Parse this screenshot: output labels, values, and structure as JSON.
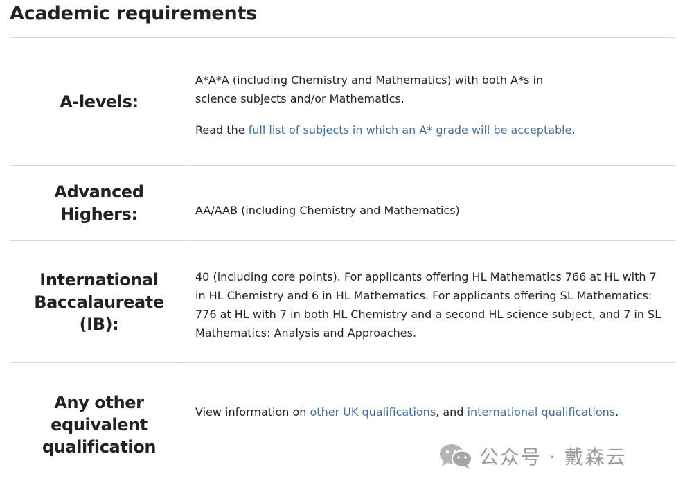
{
  "page": {
    "title": "Academic requirements"
  },
  "requirements": [
    {
      "qualification": "A-levels:",
      "paragraphs": [
        {
          "segments": [
            {
              "text": "A*A*A (including Chemistry and Mathematics) with both A*s in science subjects and/or Mathematics.",
              "link": false
            }
          ]
        },
        {
          "segments": [
            {
              "text": "Read the ",
              "link": false
            },
            {
              "text": "full list of subjects in which an A* grade will be acceptable",
              "link": true
            },
            {
              "text": ".",
              "link": false
            }
          ]
        }
      ]
    },
    {
      "qualification": "Advanced Highers:",
      "paragraphs": [
        {
          "segments": [
            {
              "text": "AA/AAB (including Chemistry and Mathematics)",
              "link": false
            }
          ]
        }
      ]
    },
    {
      "qualification": "International Baccalaureate (IB):",
      "paragraphs": [
        {
          "segments": [
            {
              "text": "40 (including core points). For applicants offering HL Mathematics 766 at HL with 7 in HL Chemistry and 6 in HL Mathematics. For applicants offering SL Mathematics: 776 at HL with 7 in both HL Chemistry and a second HL science subject, and 7 in SL Mathematics: Analysis and Approaches.",
              "link": false
            }
          ]
        }
      ]
    },
    {
      "qualification": "Any other equivalent qualification",
      "paragraphs": [
        {
          "segments": [
            {
              "text": "View information on ",
              "link": false
            },
            {
              "text": "other UK qualifications",
              "link": true
            },
            {
              "text": ", and ",
              "link": false
            },
            {
              "text": "international qualifications",
              "link": true
            },
            {
              "text": ".",
              "link": false
            }
          ]
        }
      ]
    }
  ],
  "watermark": {
    "text": "公众号 · 戴森云",
    "icon": "wechat-icon"
  },
  "colors": {
    "link": "#3d6fa0",
    "border": "#d8d8d8",
    "text": "#222222",
    "watermark": "#9a9a9a"
  }
}
